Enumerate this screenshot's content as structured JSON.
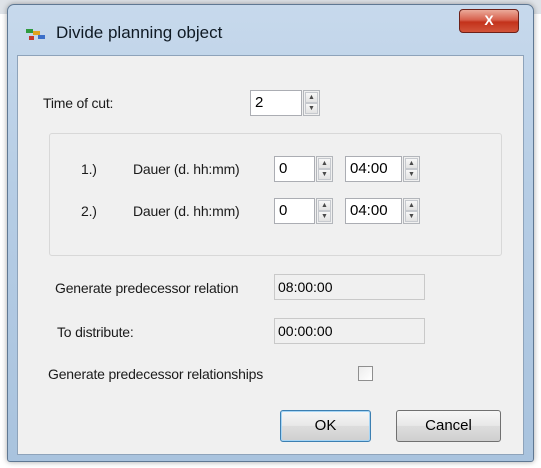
{
  "window": {
    "title": "Divide planning object",
    "close_label": "X"
  },
  "form": {
    "time_of_cut": {
      "label": "Time of cut:",
      "value": "2"
    },
    "rows": [
      {
        "index": "1.)",
        "label": "Dauer (d. hh:mm)",
        "days": "0",
        "time": "04:00"
      },
      {
        "index": "2.)",
        "label": "Dauer (d. hh:mm)",
        "days": "0",
        "time": "04:00"
      }
    ],
    "generate_relation": {
      "label": "Generate predecessor relation",
      "value": "08:00:00"
    },
    "to_distribute": {
      "label": "To distribute:",
      "value": "00:00:00"
    },
    "generate_relationships": {
      "label": "Generate predecessor relationships",
      "checked": false
    }
  },
  "buttons": {
    "ok": "OK",
    "cancel": "Cancel"
  },
  "icons": {
    "app": "divide-planning-object-icon",
    "close": "close-icon",
    "spin_up": "spin-up-arrow",
    "spin_down": "spin-down-arrow"
  },
  "colors": {
    "frame": "#b6cde5",
    "close_button": "#c3321b",
    "client": "#f0f0f0"
  }
}
